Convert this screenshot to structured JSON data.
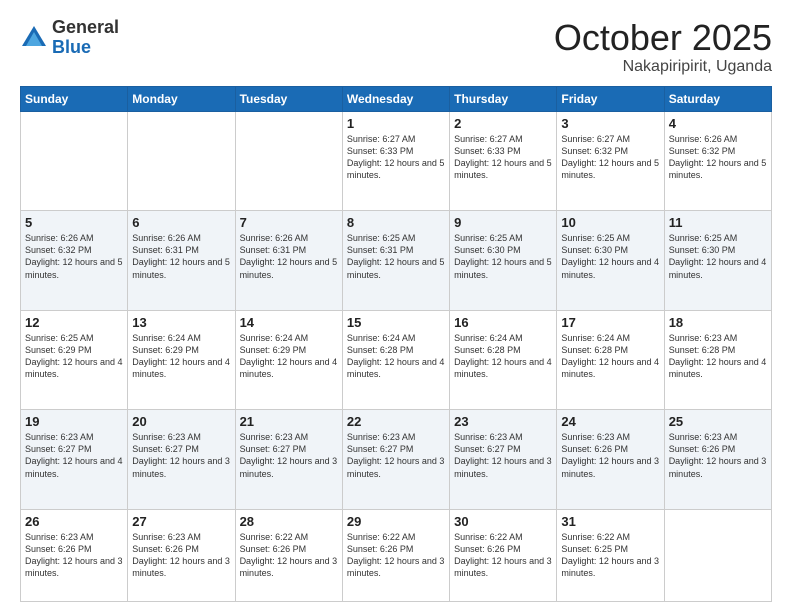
{
  "logo": {
    "general": "General",
    "blue": "Blue"
  },
  "title": {
    "month": "October 2025",
    "location": "Nakapiripirit, Uganda"
  },
  "weekdays": [
    "Sunday",
    "Monday",
    "Tuesday",
    "Wednesday",
    "Thursday",
    "Friday",
    "Saturday"
  ],
  "weeks": [
    [
      {
        "day": "",
        "info": ""
      },
      {
        "day": "",
        "info": ""
      },
      {
        "day": "",
        "info": ""
      },
      {
        "day": "1",
        "info": "Sunrise: 6:27 AM\nSunset: 6:33 PM\nDaylight: 12 hours and 5 minutes."
      },
      {
        "day": "2",
        "info": "Sunrise: 6:27 AM\nSunset: 6:33 PM\nDaylight: 12 hours and 5 minutes."
      },
      {
        "day": "3",
        "info": "Sunrise: 6:27 AM\nSunset: 6:32 PM\nDaylight: 12 hours and 5 minutes."
      },
      {
        "day": "4",
        "info": "Sunrise: 6:26 AM\nSunset: 6:32 PM\nDaylight: 12 hours and 5 minutes."
      }
    ],
    [
      {
        "day": "5",
        "info": "Sunrise: 6:26 AM\nSunset: 6:32 PM\nDaylight: 12 hours and 5 minutes."
      },
      {
        "day": "6",
        "info": "Sunrise: 6:26 AM\nSunset: 6:31 PM\nDaylight: 12 hours and 5 minutes."
      },
      {
        "day": "7",
        "info": "Sunrise: 6:26 AM\nSunset: 6:31 PM\nDaylight: 12 hours and 5 minutes."
      },
      {
        "day": "8",
        "info": "Sunrise: 6:25 AM\nSunset: 6:31 PM\nDaylight: 12 hours and 5 minutes."
      },
      {
        "day": "9",
        "info": "Sunrise: 6:25 AM\nSunset: 6:30 PM\nDaylight: 12 hours and 5 minutes."
      },
      {
        "day": "10",
        "info": "Sunrise: 6:25 AM\nSunset: 6:30 PM\nDaylight: 12 hours and 4 minutes."
      },
      {
        "day": "11",
        "info": "Sunrise: 6:25 AM\nSunset: 6:30 PM\nDaylight: 12 hours and 4 minutes."
      }
    ],
    [
      {
        "day": "12",
        "info": "Sunrise: 6:25 AM\nSunset: 6:29 PM\nDaylight: 12 hours and 4 minutes."
      },
      {
        "day": "13",
        "info": "Sunrise: 6:24 AM\nSunset: 6:29 PM\nDaylight: 12 hours and 4 minutes."
      },
      {
        "day": "14",
        "info": "Sunrise: 6:24 AM\nSunset: 6:29 PM\nDaylight: 12 hours and 4 minutes."
      },
      {
        "day": "15",
        "info": "Sunrise: 6:24 AM\nSunset: 6:28 PM\nDaylight: 12 hours and 4 minutes."
      },
      {
        "day": "16",
        "info": "Sunrise: 6:24 AM\nSunset: 6:28 PM\nDaylight: 12 hours and 4 minutes."
      },
      {
        "day": "17",
        "info": "Sunrise: 6:24 AM\nSunset: 6:28 PM\nDaylight: 12 hours and 4 minutes."
      },
      {
        "day": "18",
        "info": "Sunrise: 6:23 AM\nSunset: 6:28 PM\nDaylight: 12 hours and 4 minutes."
      }
    ],
    [
      {
        "day": "19",
        "info": "Sunrise: 6:23 AM\nSunset: 6:27 PM\nDaylight: 12 hours and 4 minutes."
      },
      {
        "day": "20",
        "info": "Sunrise: 6:23 AM\nSunset: 6:27 PM\nDaylight: 12 hours and 3 minutes."
      },
      {
        "day": "21",
        "info": "Sunrise: 6:23 AM\nSunset: 6:27 PM\nDaylight: 12 hours and 3 minutes."
      },
      {
        "day": "22",
        "info": "Sunrise: 6:23 AM\nSunset: 6:27 PM\nDaylight: 12 hours and 3 minutes."
      },
      {
        "day": "23",
        "info": "Sunrise: 6:23 AM\nSunset: 6:27 PM\nDaylight: 12 hours and 3 minutes."
      },
      {
        "day": "24",
        "info": "Sunrise: 6:23 AM\nSunset: 6:26 PM\nDaylight: 12 hours and 3 minutes."
      },
      {
        "day": "25",
        "info": "Sunrise: 6:23 AM\nSunset: 6:26 PM\nDaylight: 12 hours and 3 minutes."
      }
    ],
    [
      {
        "day": "26",
        "info": "Sunrise: 6:23 AM\nSunset: 6:26 PM\nDaylight: 12 hours and 3 minutes."
      },
      {
        "day": "27",
        "info": "Sunrise: 6:23 AM\nSunset: 6:26 PM\nDaylight: 12 hours and 3 minutes."
      },
      {
        "day": "28",
        "info": "Sunrise: 6:22 AM\nSunset: 6:26 PM\nDaylight: 12 hours and 3 minutes."
      },
      {
        "day": "29",
        "info": "Sunrise: 6:22 AM\nSunset: 6:26 PM\nDaylight: 12 hours and 3 minutes."
      },
      {
        "day": "30",
        "info": "Sunrise: 6:22 AM\nSunset: 6:26 PM\nDaylight: 12 hours and 3 minutes."
      },
      {
        "day": "31",
        "info": "Sunrise: 6:22 AM\nSunset: 6:25 PM\nDaylight: 12 hours and 3 minutes."
      },
      {
        "day": "",
        "info": ""
      }
    ]
  ]
}
